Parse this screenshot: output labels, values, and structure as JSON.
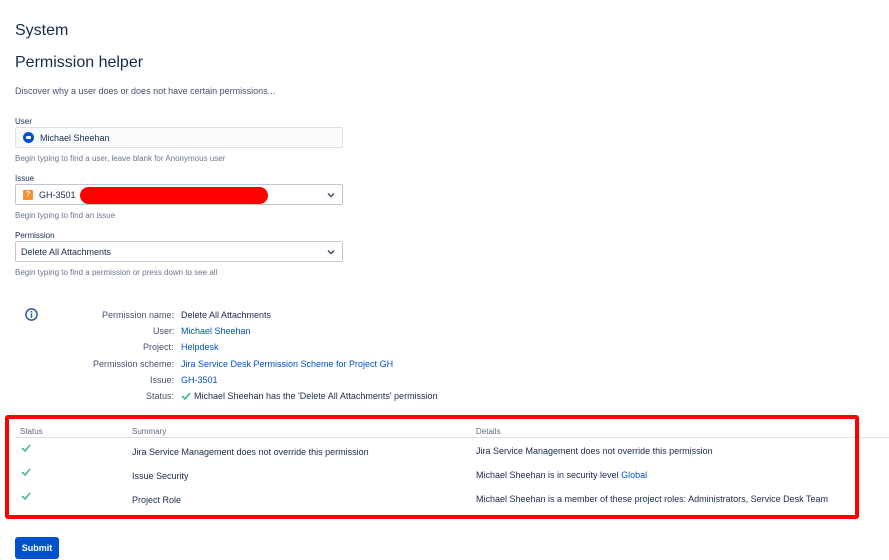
{
  "page": {
    "section_title": "System",
    "title": "Permission helper",
    "intro": "Discover why a user does or does not have certain permissions..."
  },
  "form": {
    "user_label": "User",
    "user_value": "Michael Sheehan",
    "user_hint": "Begin typing to find a user, leave blank for Anonymous user",
    "issue_label": "Issue",
    "issue_value": "GH-3501",
    "issue_hint": "Begin typing to find an issue",
    "permission_label": "Permission",
    "permission_value": "Delete All Attachments",
    "permission_hint": "Begin typing to find a permission or press down to see all"
  },
  "result": {
    "rows": [
      {
        "key": "Permission name:",
        "value": "Delete All Attachments",
        "link": false
      },
      {
        "key": "User:",
        "value": "Michael Sheehan",
        "link": true
      },
      {
        "key": "Project:",
        "value": "Helpdesk",
        "link": true
      },
      {
        "key": "Permission scheme:",
        "value": "Jira Service Desk Permission Scheme for Project GH",
        "link": true
      },
      {
        "key": "Issue:",
        "value": "GH-3501",
        "link": true
      },
      {
        "key": "Status:",
        "value": "Michael Sheehan has the 'Delete All Attachments' permission",
        "link": false
      }
    ]
  },
  "table": {
    "headers": {
      "status": "Status",
      "summary": "Summary",
      "details": "Details"
    },
    "rows": [
      {
        "summary": "Jira Service Management does not override this permission",
        "details": "Jira Service Management does not override this permission",
        "details_link": ""
      },
      {
        "summary": "Issue Security",
        "details": "Michael Sheehan is in security level",
        "details_link": "Global"
      },
      {
        "summary": "Project Role",
        "details": "Michael Sheehan is a member of these project roles: Administrators, Service Desk Team",
        "details_link": ""
      }
    ]
  },
  "submit_label": "Submit",
  "icons": {
    "info": "info-icon",
    "check": "check-icon",
    "chevron": "chevron-down-icon",
    "issue_type": "issue-type-icon",
    "avatar": "user-avatar"
  },
  "colors": {
    "link": "#0052cc",
    "check": "#36b37e",
    "annotation": "#ff0000",
    "button": "#0052cc"
  }
}
